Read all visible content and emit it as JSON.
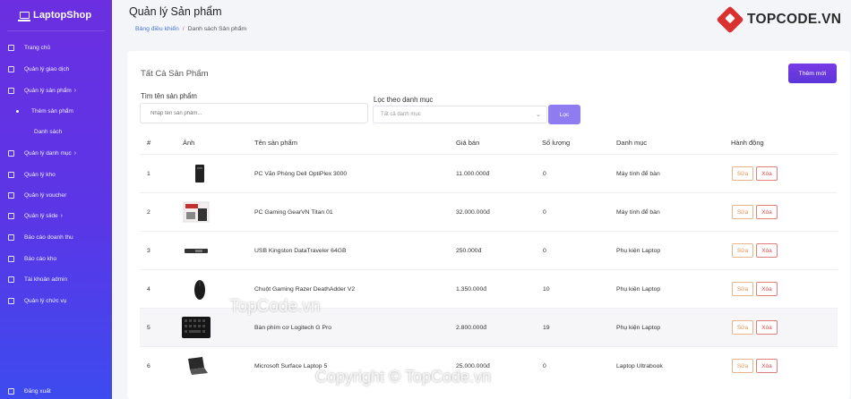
{
  "brand": {
    "name": "LaptopShop"
  },
  "sidebar": {
    "items": [
      {
        "label": "Trang chủ",
        "icon": "dashboard-icon"
      },
      {
        "label": "Quản lý giao dịch",
        "icon": "transaction-icon"
      },
      {
        "label": "Quản lý sản phẩm",
        "icon": "product-icon",
        "chevron": "›"
      },
      {
        "label": "Thêm sản phẩm",
        "icon": "dot"
      },
      {
        "label": "Danh sách",
        "icon": "dot"
      },
      {
        "label": "Quản lý danh mục",
        "icon": "category-icon",
        "chevron": "›"
      },
      {
        "label": "Quản lý kho",
        "icon": "warehouse-icon"
      },
      {
        "label": "Quản lý voucher",
        "icon": "voucher-icon"
      },
      {
        "label": "Quản lý slide",
        "icon": "slide-icon",
        "chevron": "›"
      },
      {
        "label": "Báo cáo doanh thu",
        "icon": "chart-icon"
      },
      {
        "label": "Báo cáo kho",
        "icon": "report-icon"
      },
      {
        "label": "Tài khoản admin",
        "icon": "user-icon"
      },
      {
        "label": "Quản lý chức vụ",
        "icon": "role-icon"
      }
    ],
    "logout": "Đăng xuất"
  },
  "header": {
    "title": "Quản lý Sản phẩm",
    "breadcrumb": {
      "home": "Bảng điều khiển",
      "sep": "/",
      "current": "Danh sách Sản phẩm"
    }
  },
  "logo": {
    "text": "TOPCODE.VN"
  },
  "card": {
    "title": "Tất Cả Sản Phẩm",
    "add_button": "Thêm mới",
    "search_label": "Tìm tên sản phẩm",
    "search_placeholder": "Nhập tên sản phẩm...",
    "category_label": "Lọc theo danh mục",
    "category_value": "Tất cả danh mục",
    "filter_button": "Lọc"
  },
  "table": {
    "headers": [
      "#",
      "Ảnh",
      "Tên sản phẩm",
      "Giá bán",
      "Số lượng",
      "Danh mục",
      "Hành động"
    ],
    "rows": [
      {
        "num": "1",
        "name": "PC Văn Phòng Dell OptiPlex 3000",
        "price": "11.000.000đ",
        "qty": "0",
        "category": "Máy tính để bàn"
      },
      {
        "num": "2",
        "name": "PC Gaming GearVN Titan 01",
        "price": "32.000.000đ",
        "qty": "0",
        "category": "Máy tính để bàn"
      },
      {
        "num": "3",
        "name": "USB Kingston DataTraveler 64GB",
        "price": "250.000đ",
        "qty": "0",
        "category": "Phụ kiện Laptop"
      },
      {
        "num": "4",
        "name": "Chuột Gaming Razer DeathAdder V2",
        "price": "1.350.000đ",
        "qty": "10",
        "category": "Phụ kiện Laptop"
      },
      {
        "num": "5",
        "name": "Bàn phím cơ Logitech G Pro",
        "price": "2.800.000đ",
        "qty": "19",
        "category": "Phụ kiện Laptop"
      },
      {
        "num": "6",
        "name": "Microsoft Surface Laptop 5",
        "price": "25.000.000đ",
        "qty": "0",
        "category": "Laptop Ultrabook"
      }
    ],
    "edit_label": "Sửa",
    "delete_label": "Xóa"
  },
  "watermarks": {
    "topcode": "TopCode.vn",
    "copyright": "Copyright © TopCode.vn"
  }
}
